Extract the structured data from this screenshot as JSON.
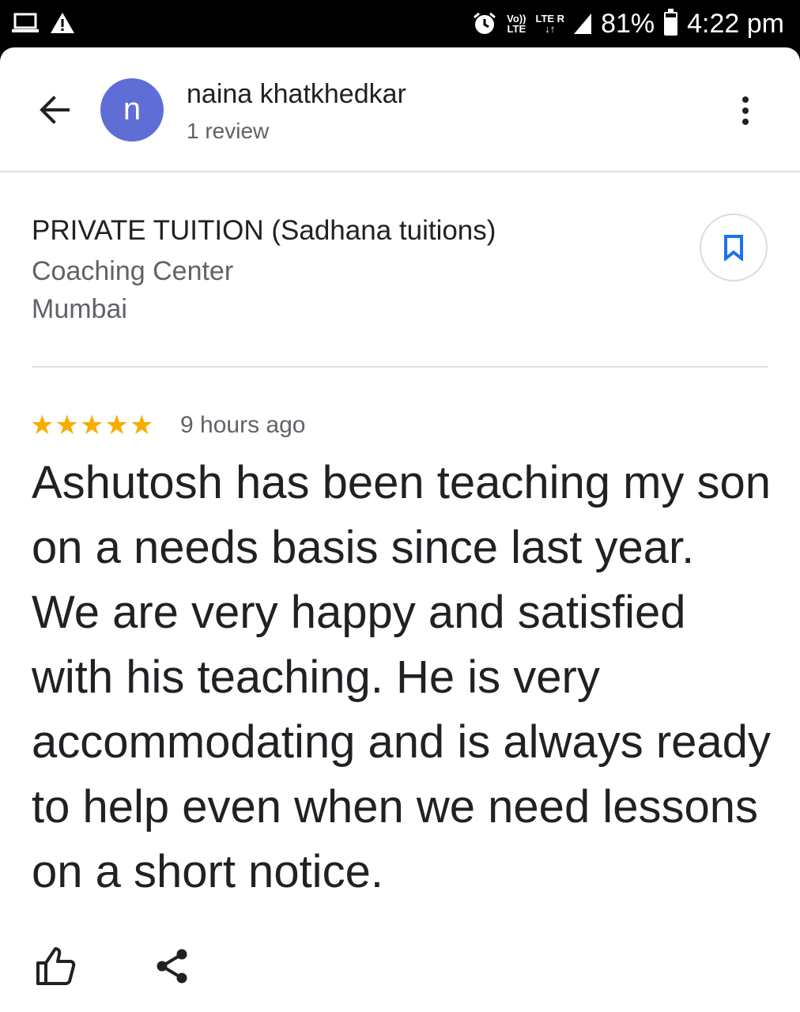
{
  "status_bar": {
    "network_top": "Vo))",
    "network_bottom": "LTE",
    "lte_label": "LTE R",
    "battery": "81%",
    "battery_level": 0.81,
    "time": "4:22 pm",
    "icons": [
      "laptop-icon",
      "warning-icon",
      "alarm-icon",
      "signal-icon",
      "battery-icon"
    ]
  },
  "header": {
    "avatar_letter": "n",
    "avatar_color": "#5e6ed6",
    "reviewer_name": "naina khatkhedkar",
    "review_count": "1 review"
  },
  "place": {
    "name": "PRIVATE TUITION (Sadhana tuitions)",
    "category": "Coaching Center",
    "city": "Mumbai"
  },
  "review": {
    "rating": 5,
    "max_rating": 5,
    "star_color": "#f9ab00",
    "time_ago": "9 hours ago",
    "text": "Ashutosh has been teaching my son on a needs basis since last year. We are very happy and satisfied with his teaching. He is very accommodating and is always ready to help even when we need lessons on a short notice."
  },
  "colors": {
    "accent": "#1a73e8",
    "text_primary": "#202124",
    "text_secondary": "#5f6368"
  }
}
